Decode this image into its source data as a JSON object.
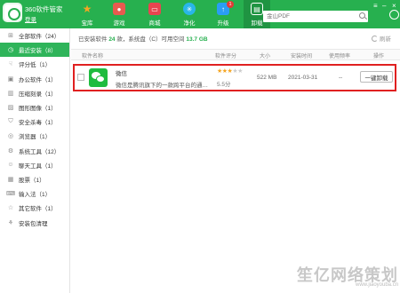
{
  "header": {
    "app_title": "360软件管家",
    "login": "登录",
    "search_placeholder": "金山PDF",
    "nav": [
      {
        "label": "宝库",
        "icon": "star-icon",
        "color": "#f6a623"
      },
      {
        "label": "游戏",
        "icon": "gamepad-icon",
        "color": "#e85a4f"
      },
      {
        "label": "商城",
        "icon": "shop-icon",
        "color": "#e8454f"
      },
      {
        "label": "净化",
        "icon": "clean-icon",
        "color": "#29b6e8"
      },
      {
        "label": "升级",
        "icon": "upgrade-icon",
        "color": "#2a9df4",
        "badge": "1"
      },
      {
        "label": "卸载",
        "icon": "trash-icon",
        "color": "#ffffff",
        "active": true
      }
    ]
  },
  "sidebar": {
    "items": [
      {
        "label": "全部软件（24）",
        "icon": "grid-icon"
      },
      {
        "label": "最近安装（8）",
        "icon": "clock-icon",
        "active": true
      },
      {
        "label": "评分低（1）",
        "icon": "thumb-down-icon"
      },
      {
        "label": "办公软件（1）",
        "icon": "office-icon"
      },
      {
        "label": "压缩刻录（1）",
        "icon": "archive-icon"
      },
      {
        "label": "图形图像（1）",
        "icon": "image-icon"
      },
      {
        "label": "安全杀毒（1）",
        "icon": "shield-icon"
      },
      {
        "label": "浏览器（1）",
        "icon": "browser-icon"
      },
      {
        "label": "系统工具（12）",
        "icon": "tools-icon"
      },
      {
        "label": "聊天工具（1）",
        "icon": "chat-icon"
      },
      {
        "label": "股票（1）",
        "icon": "stock-icon"
      },
      {
        "label": "输入法（1）",
        "icon": "keyboard-icon"
      },
      {
        "label": "其它软件（1）",
        "icon": "other-icon"
      },
      {
        "label": "安装包清理",
        "icon": "package-icon"
      }
    ]
  },
  "main": {
    "summary_prefix": "已安装软件",
    "summary_count": "24",
    "summary_mid": "款，系统盘（C）可用空间",
    "summary_space": "13.7 GB",
    "refresh_label": "刷新",
    "columns": [
      "软件名称",
      "软件评分",
      "大小",
      "安装时间",
      "使用频率",
      "操作"
    ],
    "row": {
      "name": "微信",
      "description": "微信是腾讯旗下的一款跨平台的通讯工具",
      "stars_on": "★★★",
      "stars_off": "★★",
      "score": "5.5分",
      "size": "522 MB",
      "install_date": "2021-03-31",
      "frequency": "--",
      "action": "一键卸载"
    }
  },
  "watermark": {
    "text": "笙亿网络策划",
    "sub": "www.jiaoyouba.cn"
  }
}
